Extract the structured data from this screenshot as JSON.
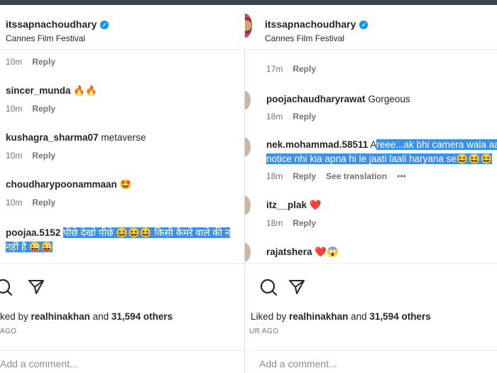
{
  "left": {
    "username": "itssapnachoudhary",
    "location": "Cannes Film Festival",
    "comments": [
      {
        "user": "",
        "text": "",
        "time": "10m",
        "reply": "Reply"
      },
      {
        "user": "sincer_munda",
        "text": "🔥🔥",
        "time": "10m",
        "reply": "Reply"
      },
      {
        "user": "kushagra_sharma07",
        "text": "metaverse",
        "time": "10m",
        "reply": "Reply"
      },
      {
        "user": "choudharypoonammaan",
        "text": "🤩",
        "time": "10m",
        "reply": "Reply"
      },
      {
        "user": "poojaa.5152",
        "text": "पीछे देखो पीछे 😆😆😆 किसी कैमरे वाले की न",
        "text2": "नहीं है 😜😜",
        "time": "",
        "reply": ""
      }
    ],
    "liked_by_prefix": "ked by",
    "liked_by_user": "realhinakhan",
    "liked_by_and": "and",
    "liked_by_count": "31,594 others",
    "ago": "AGO",
    "add_comment": "Add a comment..."
  },
  "right": {
    "username": "itssapnachoudhary",
    "location": "Cannes Film Festival",
    "comments": [
      {
        "user": "",
        "text": "",
        "time": "17m",
        "reply": "Reply"
      },
      {
        "user": "poojachaudharyrawat",
        "text": "Gorgeous",
        "time": "18m",
        "reply": "Reply"
      },
      {
        "user": "nek.mohammad.58511",
        "text_pre": "A",
        "text": "reee...ak bhi camera wala aa",
        "text2": "notice nhi kia apna hi le jaati laali haryana se😆😆😆",
        "time": "18m",
        "reply": "Reply",
        "translation": "See translation",
        "more": "•••"
      },
      {
        "user": "itz__plak",
        "text": "❤️",
        "time": "18m",
        "reply": "Reply"
      },
      {
        "user": "rajatshera",
        "text": "❤️😱",
        "time": "",
        "reply": ""
      }
    ],
    "liked_by_prefix": "Liked by",
    "liked_by_user": "realhinakhan",
    "liked_by_and": "and",
    "liked_by_count": "31,594 others",
    "ago": "UR AGO",
    "add_comment": "Add a comment..."
  },
  "colors": {
    "verified": "#0095f6",
    "highlight": "#3d8fe8",
    "secondary_text": "#737373",
    "primary_text": "#262626"
  },
  "icons": [
    "search-icon",
    "share-icon",
    "verified-badge-icon"
  ]
}
